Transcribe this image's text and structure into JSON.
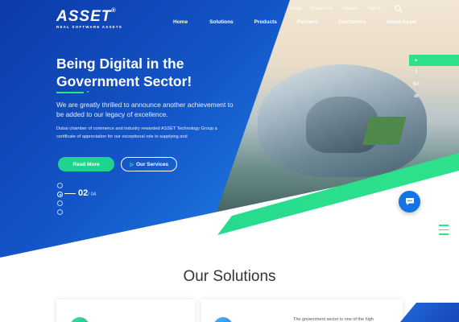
{
  "brand": {
    "logo_text": "ASSET",
    "logo_registered": "®",
    "logo_tagline": "REAL SOFTWARE ASSETS"
  },
  "topbar": {
    "links": [
      "News",
      "Contact Us",
      "Careers",
      "Sign In"
    ]
  },
  "nav": {
    "items": [
      "Home",
      "Solutions",
      "Products",
      "Partners",
      "Customers",
      "About Asset"
    ]
  },
  "hero": {
    "title": "Being Digital in the Government Sector!",
    "lead": "We are greatly thrilled to announce another achievement to be added to our legacy of excellence.",
    "body": "Dubai chamber of commerce and industry rewarded ASSET Technology Group a certificate of appreciation for our exceptional role in supplying and",
    "read_more": "Read More",
    "our_services": "Our Services",
    "slide_current": "02",
    "slide_total": "/ 04"
  },
  "social": {
    "items": [
      "twitter-icon",
      "facebook-icon",
      "google-plus-icon",
      "linkedin-icon"
    ],
    "glyphs": [
      "✦",
      "f",
      "G+",
      "in"
    ]
  },
  "solutions": {
    "title": "Our Solutions",
    "card2_text": "The government sector is one of the high"
  },
  "colors": {
    "primary_blue": "#1356c9",
    "accent_green": "#2ee28c",
    "chat_blue": "#1473e6"
  }
}
